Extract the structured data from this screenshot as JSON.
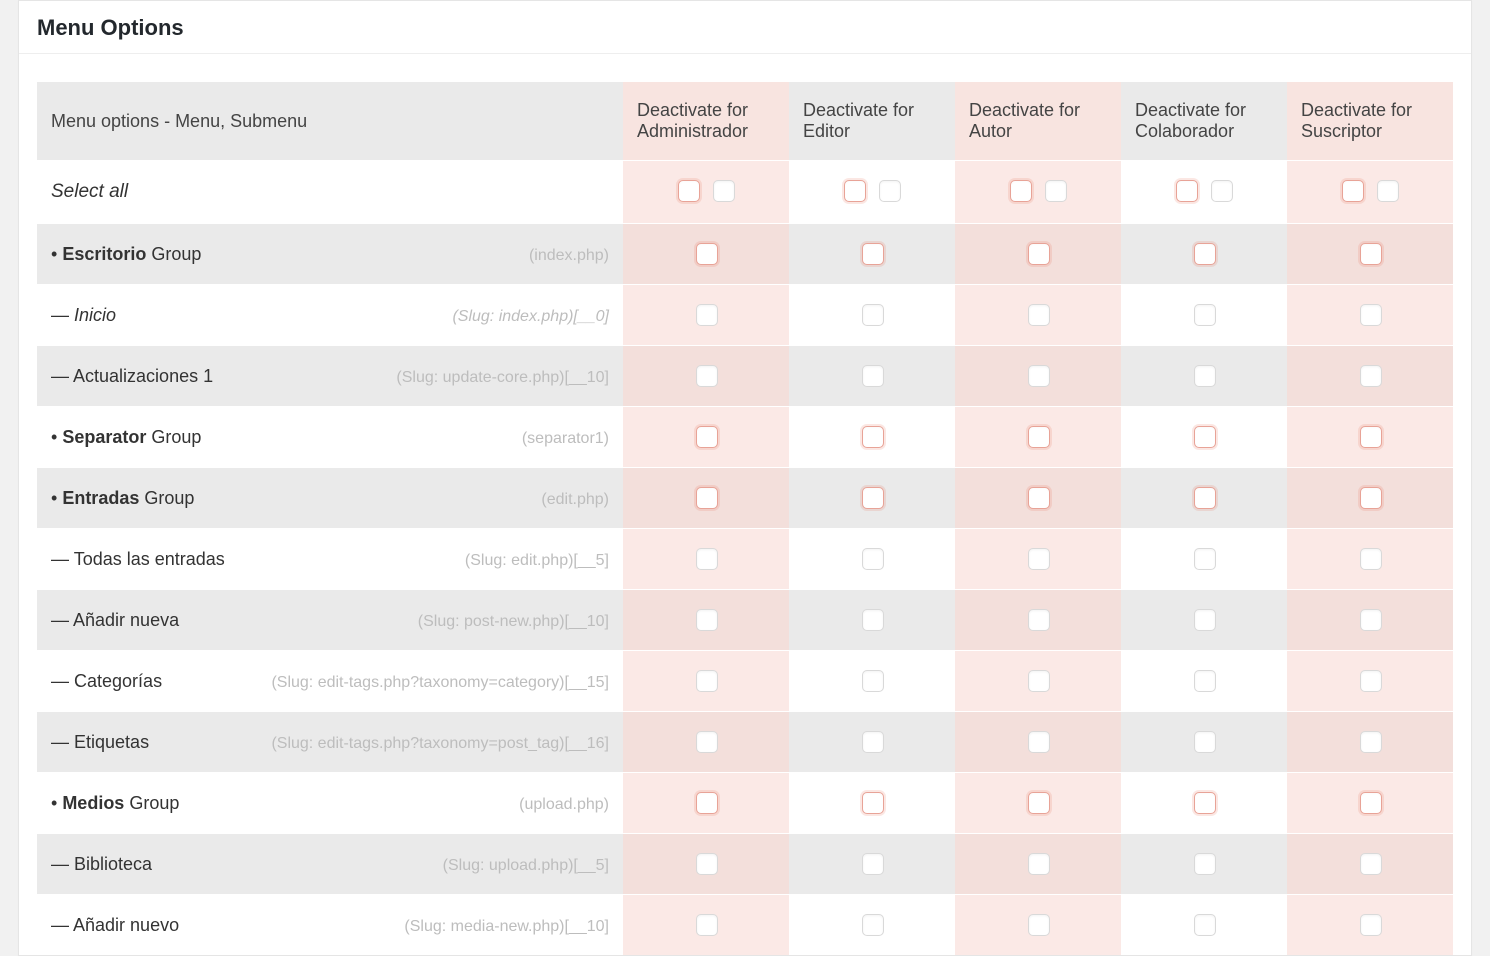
{
  "header": {
    "title": "Menu Options"
  },
  "table": {
    "first_header": "Menu options - Menu, Submenu",
    "role_header_prefix": "Deactivate for",
    "roles": [
      "Administrador",
      "Editor",
      "Autor",
      "Colaborador",
      "Suscriptor"
    ],
    "select_all_label": "Select all",
    "group_suffix": "Group",
    "rows": [
      {
        "id": "escritorio",
        "type": "group",
        "bullet": "•",
        "label": "Escritorio",
        "slug": "(index.php)",
        "redcb": true,
        "zebra": true
      },
      {
        "id": "inicio",
        "type": "sub",
        "bullet": "—",
        "label": "Inicio",
        "italic": true,
        "slug": "(Slug: index.php)[__0]",
        "slug_italic": true,
        "redcb": false,
        "zebra": false
      },
      {
        "id": "actualizaciones",
        "type": "sub",
        "bullet": "—",
        "label": "Actualizaciones 1",
        "slug": "(Slug: update-core.php)[__10]",
        "redcb": false,
        "zebra": true
      },
      {
        "id": "separator",
        "type": "group",
        "bullet": "•",
        "label": "Separator",
        "slug": "(separator1)",
        "redcb": true,
        "zebra": false
      },
      {
        "id": "entradas",
        "type": "group",
        "bullet": "•",
        "label": "Entradas",
        "slug": "(edit.php)",
        "redcb": true,
        "zebra": true
      },
      {
        "id": "todas-entradas",
        "type": "sub",
        "bullet": "—",
        "label": "Todas las entradas",
        "slug": "(Slug: edit.php)[__5]",
        "redcb": false,
        "zebra": false
      },
      {
        "id": "anadir-nueva",
        "type": "sub",
        "bullet": "—",
        "label": "Añadir nueva",
        "slug": "(Slug: post-new.php)[__10]",
        "redcb": false,
        "zebra": true
      },
      {
        "id": "categorias",
        "type": "sub",
        "bullet": "—",
        "label": "Categorías",
        "slug": "(Slug: edit-tags.php?taxonomy=category)[__15]",
        "redcb": false,
        "zebra": false
      },
      {
        "id": "etiquetas",
        "type": "sub",
        "bullet": "—",
        "label": "Etiquetas",
        "slug": "(Slug: edit-tags.php?taxonomy=post_tag)[__16]",
        "redcb": false,
        "zebra": true
      },
      {
        "id": "medios",
        "type": "group",
        "bullet": "•",
        "label": "Medios",
        "slug": "(upload.php)",
        "redcb": true,
        "zebra": false
      },
      {
        "id": "biblioteca",
        "type": "sub",
        "bullet": "—",
        "label": "Biblioteca",
        "slug": "(Slug: upload.php)[__5]",
        "redcb": false,
        "zebra": true
      },
      {
        "id": "anadir-nuevo",
        "type": "sub",
        "bullet": "—",
        "label": "Añadir nuevo",
        "slug": "(Slug: media-new.php)[__10]",
        "redcb": false,
        "zebra": false
      }
    ]
  }
}
